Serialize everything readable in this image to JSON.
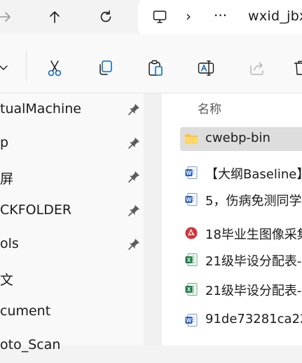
{
  "address_bar": {
    "more_label": "···",
    "chevron": "›",
    "path_segment": "wxid_jbx"
  },
  "column_headers": {
    "name": "名称"
  },
  "nav_items": [
    {
      "label": "tualMachine"
    },
    {
      "label": "p"
    },
    {
      "label": "屏"
    },
    {
      "label": "CKFOLDER"
    },
    {
      "label": "ols"
    },
    {
      "label": "文"
    },
    {
      "label": "cument"
    },
    {
      "label": "oto_Scan"
    }
  ],
  "files": [
    {
      "name": "cwebp-bin",
      "type": "folder"
    },
    {
      "name": "【大纲Baseline】",
      "type": "word"
    },
    {
      "name": "5，伤病免测同学",
      "type": "word"
    },
    {
      "name": "18毕业生图像采集",
      "type": "pdf"
    },
    {
      "name": "21级毕设分配表-",
      "type": "excel"
    },
    {
      "name": "21级毕设分配表-",
      "type": "excel"
    },
    {
      "name": "91de73281ca22",
      "type": "word"
    }
  ],
  "colors": {
    "folder": "#f6c24a",
    "word": "#2b5fb4",
    "excel": "#1e7c45",
    "pdf": "#d13438",
    "accent": "#0f6cbd"
  }
}
